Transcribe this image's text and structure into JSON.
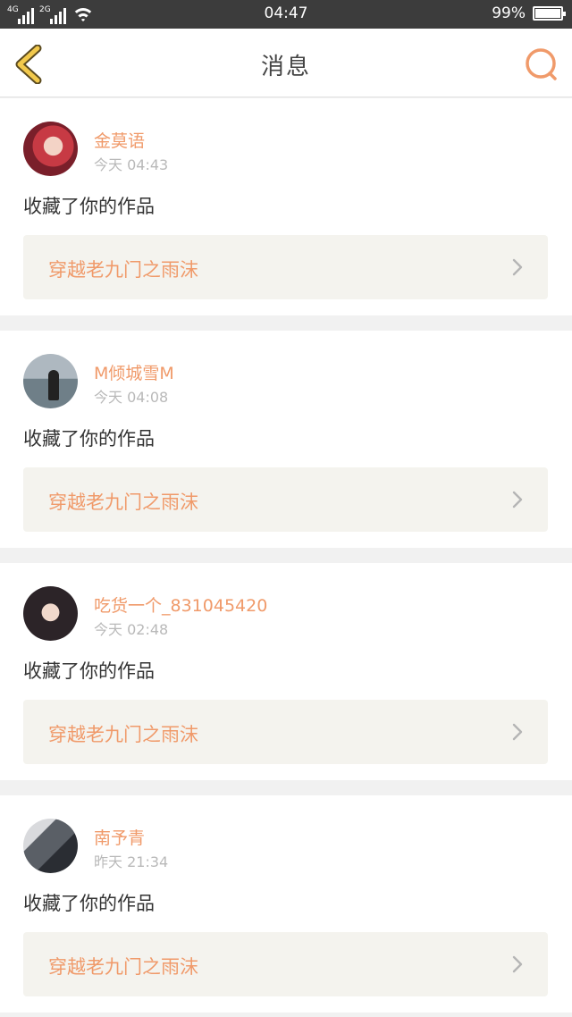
{
  "status_bar": {
    "network_1": "4G",
    "network_2": "2G",
    "time": "04:47",
    "battery": "99%",
    "battery_level": 0.99
  },
  "header": {
    "title": "消息",
    "back_icon": "chevron-left-icon",
    "search_icon": "search-icon"
  },
  "colors": {
    "accent": "#f09a6a",
    "back_icon": "#f2c94c"
  },
  "messages": [
    {
      "user": "金莫语",
      "time": "今天 04:43",
      "action": "收藏了你的作品",
      "work": "穿越老九门之雨沫"
    },
    {
      "user": "M倾城雪M",
      "time": "今天 04:08",
      "action": "收藏了你的作品",
      "work": "穿越老九门之雨沫"
    },
    {
      "user": "吃货一个_831045420",
      "time": "今天 02:48",
      "action": "收藏了你的作品",
      "work": "穿越老九门之雨沫"
    },
    {
      "user": "南予青",
      "time": "昨天 21:34",
      "action": "收藏了你的作品",
      "work": "穿越老九门之雨沫"
    }
  ]
}
